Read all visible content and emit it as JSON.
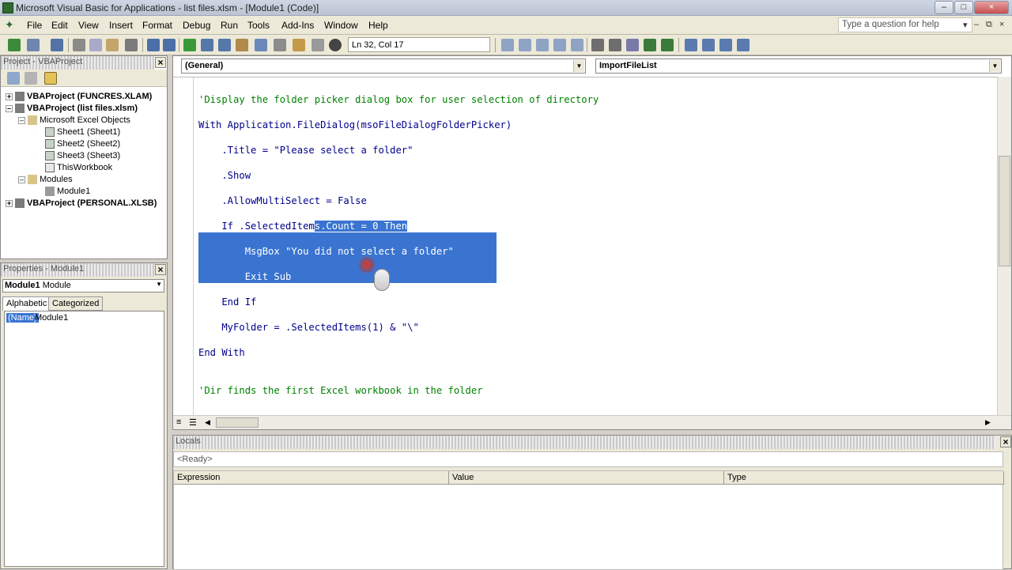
{
  "window": {
    "title": "Microsoft Visual Basic for Applications - list files.xlsm - [Module1 (Code)]",
    "controls": [
      "–",
      "□",
      "×"
    ]
  },
  "menu": {
    "items": [
      "File",
      "Edit",
      "View",
      "Insert",
      "Format",
      "Debug",
      "Run",
      "Tools",
      "Add-Ins",
      "Window",
      "Help"
    ],
    "help_placeholder": "Type a question for help",
    "mdi_controls": [
      "▾",
      "–",
      "⧉",
      "×"
    ]
  },
  "toolbar": {
    "position": "Ln 32, Col 17"
  },
  "project": {
    "title": "Project - VBAProject",
    "nodes": [
      {
        "label": "VBAProject (FUNCRES.XLAM)",
        "toggle": "+"
      },
      {
        "label": "VBAProject (list files.xlsm)",
        "toggle": "–"
      },
      {
        "label": "Microsoft Excel Objects",
        "toggle": "–"
      },
      {
        "label": "Sheet1 (Sheet1)"
      },
      {
        "label": "Sheet2 (Sheet2)"
      },
      {
        "label": "Sheet3 (Sheet3)"
      },
      {
        "label": "ThisWorkbook"
      },
      {
        "label": "Modules",
        "toggle": "–"
      },
      {
        "label": "Module1"
      },
      {
        "label": "VBAProject (PERSONAL.XLSB)",
        "toggle": "+"
      }
    ]
  },
  "properties": {
    "title": "Properties - Module1",
    "object_name": "Module1",
    "object_type": "Module",
    "tabs": [
      "Alphabetic",
      "Categorized"
    ],
    "row_name": "(Name)",
    "row_value": "Module1"
  },
  "code": {
    "object_combo": "(General)",
    "proc_combo": "ImportFileList",
    "lines": {
      "l1": "'Display the folder picker dialog box for user selection of directory",
      "l2": "With Application.FileDialog(msoFileDialogFolderPicker)",
      "l3": "    .Title = \"Please select a folder\"",
      "l4": "    .Show",
      "l5": "    .AllowMultiSelect = False",
      "l6a": "    If .SelectedItem",
      "l6b": "s.Count = 0 Then",
      "l7": "        MsgBox \"You did not select a folder\"",
      "l8": "        Exit Sub",
      "l9": "    End If",
      "l10": "    MyFolder = .SelectedItems(1) & \"\\\"",
      "l11": "End With",
      "l12": "'Dir finds the first Excel workbook in the folder"
    }
  },
  "locals": {
    "title": "Locals",
    "status": "<Ready>",
    "columns": [
      "Expression",
      "Value",
      "Type"
    ]
  },
  "colors": {
    "comment": "#008000",
    "keyword": "#00008b",
    "selection": "#3a74d0"
  }
}
